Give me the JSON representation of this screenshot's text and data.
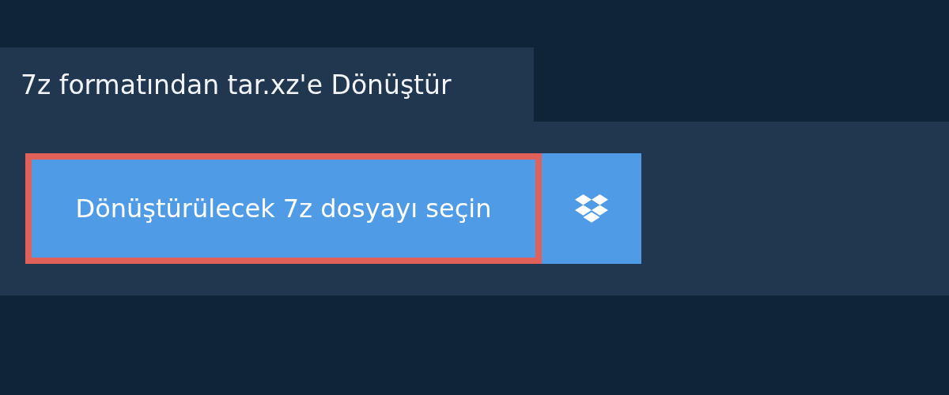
{
  "tab": {
    "title": "7z formatından tar.xz'e Dönüştür"
  },
  "upload": {
    "label": "Dönüştürülecek 7z dosyayı seçin"
  }
}
